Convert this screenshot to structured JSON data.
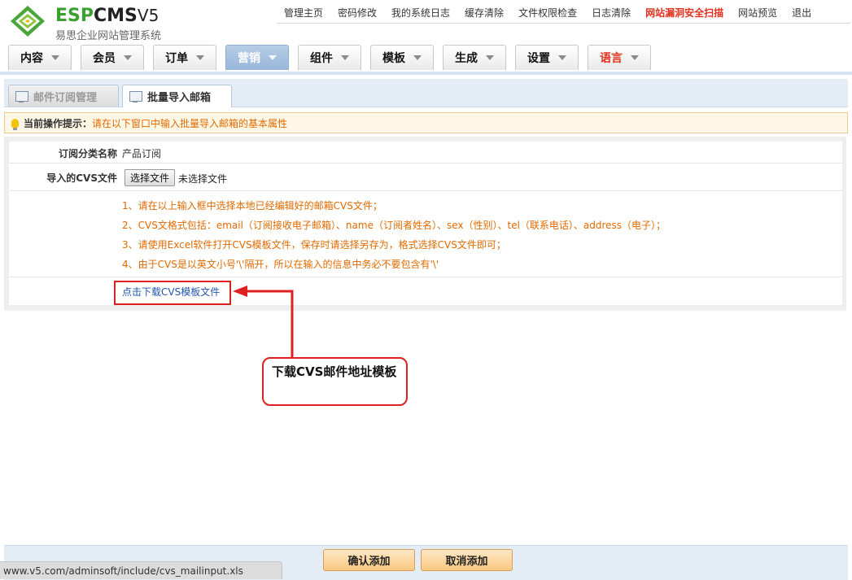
{
  "logo": {
    "esp": "ESP",
    "cms": "CMS",
    "version": "V5",
    "subtitle": "易思企业网站管理系统"
  },
  "topnav": [
    "管理主页",
    "密码修改",
    "我的系统日志",
    "缓存清除",
    "文件权限检查",
    "日志清除",
    "网站漏洞安全扫描",
    "网站预览",
    "退出"
  ],
  "mainnav": [
    "内容",
    "会员",
    "订单",
    "营销",
    "组件",
    "模板",
    "生成",
    "设置",
    "语言"
  ],
  "subtabs": [
    "邮件订阅管理",
    "批量导入邮箱"
  ],
  "tip": {
    "label": "当前操作提示：",
    "text": "请在以下窗口中输入批量导入邮箱的基本属性"
  },
  "form": {
    "category_label": "订阅分类名称",
    "category_value": "产品订阅",
    "file_label": "导入的CVS文件",
    "file_button": "选择文件",
    "file_status": "未选择文件",
    "notes": [
      "1、请在以上输入框中选择本地已经编辑好的邮箱CVS文件；",
      "2、CVS文格式包括：email（订阅接收电子邮箱）、name（订阅者姓名）、sex（性别）、tel（联系电话）、address（电子）；",
      "3、请使用Excel软件打开CVS模板文件，保存时请选择另存为，格式选择CVS文件即可；",
      "4、由于CVS是以英文小号'\\'隔开，所以在输入的信息中务必不要包含有'\\'"
    ],
    "download_link": "点击下载CVS模板文件"
  },
  "callout": "下载CVS邮件地址模板",
  "buttons": {
    "confirm": "确认添加",
    "cancel": "取消添加"
  },
  "statusbar": "www.v5.com/adminsoft/include/cvs_mailinput.xls",
  "colors": {
    "accent_red": "#e02020",
    "note_orange": "#e06a00",
    "active_tab": "#97b6d9",
    "link_blue": "#2255aa"
  }
}
